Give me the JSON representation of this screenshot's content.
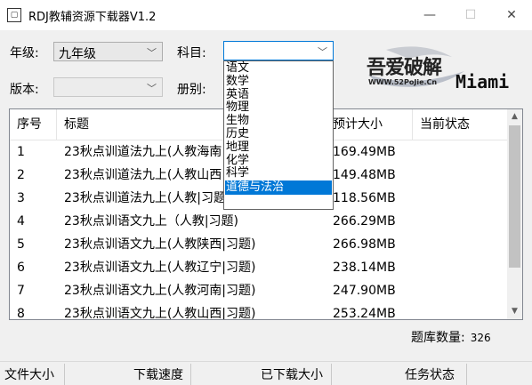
{
  "window": {
    "title": "RDJ教辅资源下载器V1.2",
    "minimize_glyph": "—",
    "maximize_glyph": "☐",
    "close_glyph": "✕"
  },
  "filters": {
    "grade_label": "年级:",
    "grade_value": "九年级",
    "subject_label": "科目:",
    "subject_value": "",
    "edition_label": "版本:",
    "edition_value": "",
    "volume_label": "册别:"
  },
  "subject_dropdown": {
    "options": [
      "语文",
      "数学",
      "英语",
      "物理",
      "生物",
      "历史",
      "地理",
      "化学",
      "科学",
      "道德与法治"
    ],
    "highlighted": "道德与法治"
  },
  "logo": {
    "main_text": "吾爱破解",
    "url_text": "WWW.52PoJie.Cn",
    "name_text": "Miami"
  },
  "table": {
    "columns": [
      "序号",
      "标题",
      "预计大小",
      "当前状态"
    ],
    "rows": [
      {
        "index": "1",
        "title": "23秋点训道法九上(人教海南|习题)",
        "size": "169.49MB",
        "status": ""
      },
      {
        "index": "2",
        "title": "23秋点训道法九上(人教山西|习题)",
        "size": "149.48MB",
        "status": ""
      },
      {
        "index": "3",
        "title": "23秋点训道法九上(人教|习题)",
        "size": "118.56MB",
        "status": ""
      },
      {
        "index": "4",
        "title": "23秋点训语文九上（人教|习题)",
        "size": "266.29MB",
        "status": ""
      },
      {
        "index": "5",
        "title": "23秋点训语文九上(人教陕西|习题)",
        "size": "266.98MB",
        "status": ""
      },
      {
        "index": "6",
        "title": "23秋点训语文九上(人教辽宁|习题)",
        "size": "238.14MB",
        "status": ""
      },
      {
        "index": "7",
        "title": "23秋点训语文九上(人教河南|习题)",
        "size": "247.90MB",
        "status": ""
      },
      {
        "index": "8",
        "title": "23秋点训语文九上(人教山西|习题)",
        "size": "253.24MB",
        "status": ""
      }
    ]
  },
  "library_count": {
    "label": "题库数量:",
    "value": "326"
  },
  "statusbar": {
    "file_size": "文件大小",
    "speed": "下载速度",
    "downloaded": "已下载大小",
    "task_status": "任务状态"
  }
}
